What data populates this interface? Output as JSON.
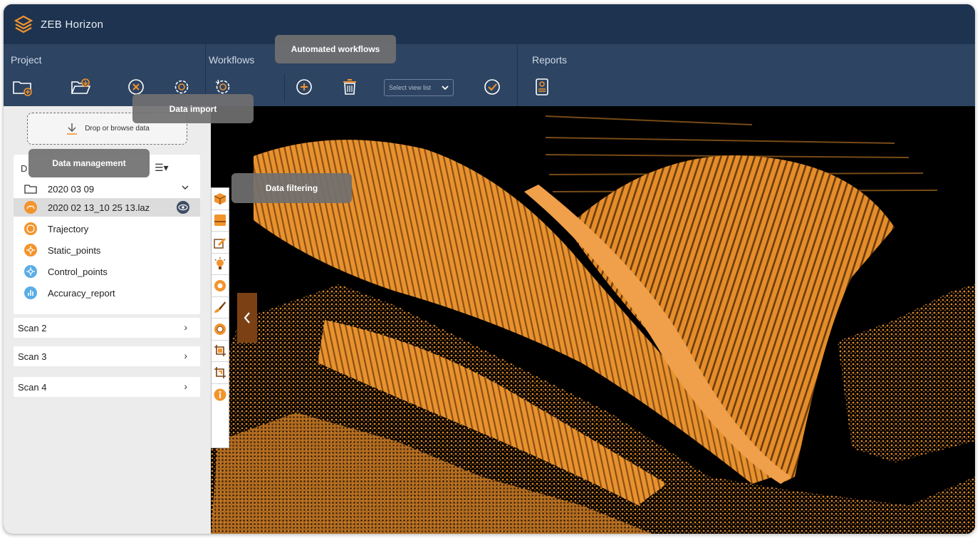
{
  "app": {
    "title": "ZEB  Horizon"
  },
  "ribbon": {
    "sections": {
      "project": "Project",
      "workflows": "Workflows",
      "reports": "Reports"
    },
    "select_view_label": "Select view list"
  },
  "sidebar": {
    "drop_label": "Drop or browse data",
    "header_letter": "D",
    "tree": [
      {
        "label": "2020 03 09",
        "icon": "folder-icon"
      },
      {
        "label": "2020 02 13_10 25 13.laz",
        "icon": "cloud-icon"
      },
      {
        "label": "Trajectory",
        "icon": "trajectory-icon"
      },
      {
        "label": "Static_points",
        "icon": "static-points-icon"
      },
      {
        "label": "Control_points",
        "icon": "control-points-icon"
      },
      {
        "label": "Accuracy_report",
        "icon": "accuracy-report-icon"
      }
    ],
    "scans": [
      {
        "label": "Scan 2"
      },
      {
        "label": "Scan 3"
      },
      {
        "label": "Scan 4"
      }
    ]
  },
  "tooltips": {
    "automated_workflows": "Automated workflows",
    "data_import": "Data import",
    "data_management": "Data management",
    "data_filtering": "Data filtering"
  },
  "colors": {
    "titlebar": "#1e3350",
    "ribbon": "#2d4462",
    "accent": "#f2942c",
    "point_cloud": "#e8922f",
    "collapse_tab": "#7b4114"
  }
}
